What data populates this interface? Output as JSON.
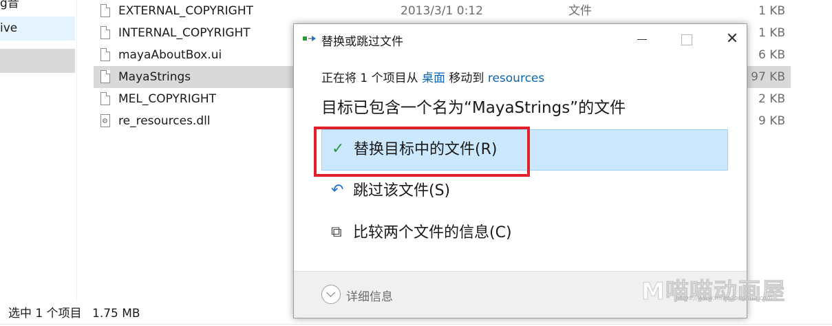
{
  "nav": {
    "top_fragment": "g音",
    "onedrive_fragment": "ive"
  },
  "files": [
    {
      "name": "EXTERNAL_COPYRIGHT",
      "date": "2013/3/1 0:12",
      "type": "文件",
      "size": "1 KB"
    },
    {
      "name": "INTERNAL_COPYRIGHT",
      "date": "",
      "type": "",
      "size": "1 KB"
    },
    {
      "name": "mayaAboutBox.ui",
      "date": "",
      "type": "",
      "size": "6 KB"
    },
    {
      "name": "MayaStrings",
      "date": "",
      "type": "",
      "size": "97 KB"
    },
    {
      "name": "MEL_COPYRIGHT",
      "date": "",
      "type": "",
      "size": "2 KB"
    },
    {
      "name": "re_resources.dll",
      "date": "",
      "type": "",
      "size": "9 KB"
    }
  ],
  "status": {
    "count": "选中 1 个项目",
    "size": "1.75 MB"
  },
  "dialog": {
    "title": "替换或跳过文件",
    "info_prefix": "正在将 1 个项目从 ",
    "info_source": "桌面",
    "info_middle": " 移动到 ",
    "info_dest": "resources",
    "heading": "目标已包含一个名为“MayaStrings”的文件",
    "options": [
      {
        "label": "替换目标中的文件(R)",
        "icon": "check-icon"
      },
      {
        "label": "跳过该文件(S)",
        "icon": "skip-icon"
      },
      {
        "label": "比较两个文件的信息(C)",
        "icon": "compare-icon"
      }
    ],
    "footer_label": "详细信息",
    "close_glyph": "✕"
  },
  "watermark": {
    "text": "M喵喵动画屋",
    "url": "https://www.miaodonghua.com"
  },
  "colors": {
    "highlight": "#cce8ff",
    "red_box": "#e2202a",
    "link": "#0b64b5",
    "check": "#2b9a3f"
  }
}
